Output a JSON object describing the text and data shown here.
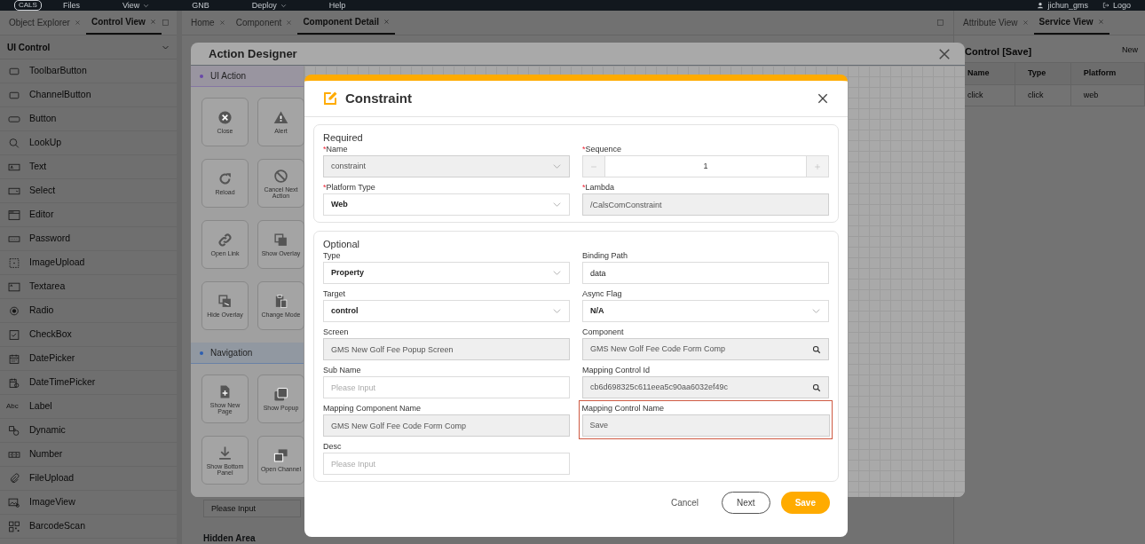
{
  "menu_bar": {
    "logo": "CALS",
    "items": [
      {
        "label": "Files",
        "dropdown": false
      },
      {
        "label": "View",
        "dropdown": true
      },
      {
        "label": "GNB",
        "dropdown": false
      },
      {
        "label": "Deploy",
        "dropdown": true
      },
      {
        "label": "Help",
        "dropdown": false
      }
    ],
    "user": "jichun_gms",
    "logout": "Logo"
  },
  "left_panel": {
    "tabs": [
      {
        "label": "Object Explorer",
        "selected": false
      },
      {
        "label": "Control View",
        "selected": true
      }
    ],
    "group": {
      "title": "UI Control",
      "expanded": true
    },
    "items": [
      {
        "label": "ToolbarButton"
      },
      {
        "label": "ChannelButton"
      },
      {
        "label": "Button"
      },
      {
        "label": "LookUp"
      },
      {
        "label": "Text"
      },
      {
        "label": "Select"
      },
      {
        "label": "Editor"
      },
      {
        "label": "Password"
      },
      {
        "label": "ImageUpload"
      },
      {
        "label": "Textarea"
      },
      {
        "label": "Radio"
      },
      {
        "label": "CheckBox"
      },
      {
        "label": "DatePicker"
      },
      {
        "label": "DateTimePicker"
      },
      {
        "label": "Label",
        "glyph": "Abc"
      },
      {
        "label": "Dynamic"
      },
      {
        "label": "Number"
      },
      {
        "label": "FileUpload"
      },
      {
        "label": "ImageView"
      },
      {
        "label": "BarcodeScan"
      }
    ]
  },
  "center_panel": {
    "tabs": [
      {
        "label": "Home",
        "selected": false
      },
      {
        "label": "Component",
        "selected": false
      },
      {
        "label": "Component Detail",
        "selected": true
      }
    ],
    "placeholder": "Please Input",
    "hidden_area": "Hidden Area"
  },
  "right_panel": {
    "tabs": [
      {
        "label": "Attribute View",
        "selected": false
      },
      {
        "label": "Service View",
        "selected": true
      }
    ],
    "title": "Control [Save]",
    "action": "New",
    "table": {
      "columns": [
        "Name",
        "Type",
        "Platform"
      ],
      "rows": [
        [
          "click",
          "click",
          "web"
        ]
      ]
    }
  },
  "action_designer": {
    "title": "Action Designer",
    "sections": [
      {
        "title": "UI Action",
        "color": "#6a48a8",
        "actions": [
          "Close",
          "Alert",
          "Reload",
          "Cancel Next Action",
          "Open Link",
          "Show Overlay",
          "Hide Overlay",
          "Change Mode"
        ]
      },
      {
        "title": "Navigation",
        "color": "#2d5fb0",
        "actions": [
          "Show New Page",
          "Show Popup",
          "Show Bottom Panel",
          "Open Channel"
        ]
      }
    ]
  },
  "constraint_dialog": {
    "title": "Constraint",
    "required_mark": "*",
    "sections": [
      {
        "title": "Required",
        "fields": [
          {
            "label": "Name",
            "required": true,
            "kind": "select",
            "value": "constraint",
            "disabled": true
          },
          {
            "label": "Sequence",
            "required": true,
            "kind": "stepper",
            "value": "1",
            "disabled": false
          },
          {
            "label": "Platform Type",
            "required": true,
            "kind": "select",
            "value": "Web",
            "disabled": false
          },
          {
            "label": "Lambda",
            "required": true,
            "kind": "input",
            "value": "/CalsComConstraint",
            "disabled": true
          }
        ]
      },
      {
        "title": "Optional",
        "fields": [
          {
            "label": "Type",
            "required": false,
            "kind": "select",
            "value": "Property",
            "disabled": false
          },
          {
            "label": "Binding Path",
            "required": false,
            "kind": "input",
            "value": "data",
            "disabled": false
          },
          {
            "label": "Target",
            "required": false,
            "kind": "select",
            "value": "control",
            "disabled": false
          },
          {
            "label": "Async Flag",
            "required": false,
            "kind": "select",
            "value": "N/A",
            "disabled": false
          },
          {
            "label": "Screen",
            "required": false,
            "kind": "input",
            "value": "GMS New Golf Fee Popup Screen",
            "disabled": true
          },
          {
            "label": "Component",
            "required": false,
            "kind": "search",
            "value": "GMS New Golf Fee Code Form Comp",
            "disabled": true
          },
          {
            "label": "Sub Name",
            "required": false,
            "kind": "input",
            "placeholder": "Please Input",
            "disabled": false
          },
          {
            "label": "Mapping Control Id",
            "required": false,
            "kind": "search",
            "value": "cb6d698325c611eea5c90aa6032ef49c",
            "disabled": true
          },
          {
            "label": "Mapping Component Name",
            "required": false,
            "kind": "input",
            "value": "GMS New Golf Fee Code Form Comp",
            "disabled": true
          },
          {
            "label": "Mapping Control Name",
            "required": false,
            "kind": "input",
            "value": "Save",
            "disabled": true,
            "highlighted": true
          },
          {
            "label": "Desc",
            "required": false,
            "kind": "input",
            "placeholder": "Please Input",
            "disabled": false
          }
        ]
      }
    ],
    "buttons": [
      {
        "label": "Cancel",
        "kind": "text"
      },
      {
        "label": "Next",
        "kind": "outline"
      },
      {
        "label": "Save",
        "kind": "primary"
      }
    ]
  }
}
